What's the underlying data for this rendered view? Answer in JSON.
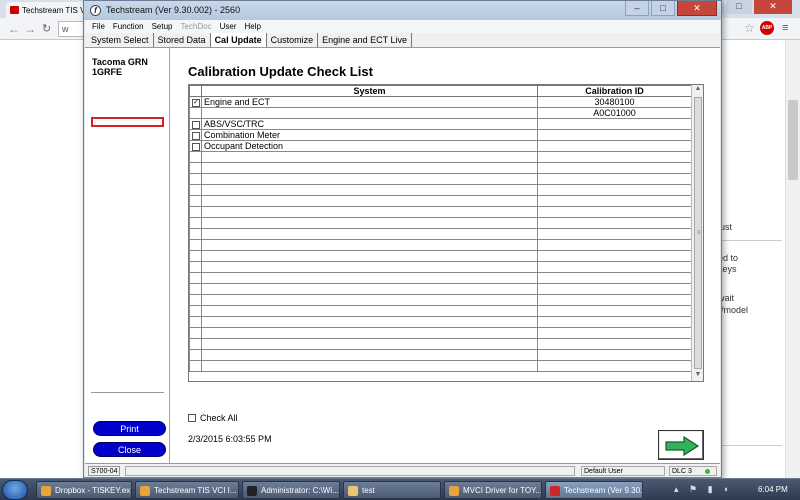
{
  "browser": {
    "tab_title": "Techstream TIS V",
    "url_text": "w",
    "window_buttons": [
      "–",
      "□",
      "✕"
    ],
    "page_text": [
      "just",
      "ed to",
      "keys",
      "wait",
      "r/model"
    ]
  },
  "window": {
    "title": "Techstream (Ver 9.30.002) - 2560",
    "app_icon": "f",
    "buttons": [
      "–",
      "□",
      "✕"
    ]
  },
  "menu": [
    "File",
    "Function",
    "Setup",
    "TechDoc",
    "User",
    "Help"
  ],
  "tabs": [
    "System Select",
    "Stored Data",
    "Cal Update",
    "Customize",
    "Engine and ECT Live"
  ],
  "active_tab": "Cal Update",
  "vehicle": {
    "model": "Tacoma GRN",
    "engine": "1GRFE"
  },
  "left_buttons": {
    "print": "Print",
    "close": "Close"
  },
  "main": {
    "title": "Calibration Update Check List",
    "columns": [
      "System",
      "Calibration ID"
    ],
    "rows": [
      {
        "checkbox": true,
        "checked": true,
        "system": "Engine and ECT",
        "calibration_id": "30480100"
      },
      {
        "checkbox": false,
        "checked": false,
        "system": "",
        "calibration_id": "A0C01000"
      },
      {
        "checkbox": true,
        "checked": false,
        "system": "ABS/VSC/TRC",
        "calibration_id": ""
      },
      {
        "checkbox": true,
        "checked": false,
        "system": "Combination Meter",
        "calibration_id": ""
      },
      {
        "checkbox": true,
        "checked": false,
        "system": "Occupant Detection",
        "calibration_id": ""
      }
    ],
    "check_all_label": "Check All",
    "timestamp": "2/3/2015 6:03:55 PM"
  },
  "status": {
    "code": "S700-04",
    "user": "Default User",
    "dlc": "DLC 3"
  },
  "taskbar": {
    "items": [
      "Dropbox - TISKEY.ex...",
      "Techstream TIS VCI I...",
      "Administrator: C:\\Wi...",
      "test",
      "MVCI Driver for TOY...",
      "Techstream (Ver 9.30..."
    ],
    "clock": "6:04 PM"
  },
  "colors": {
    "accent_blue": "#0000cc",
    "highlight_red": "#d3202a",
    "arrow_green": "#2fb45a"
  }
}
